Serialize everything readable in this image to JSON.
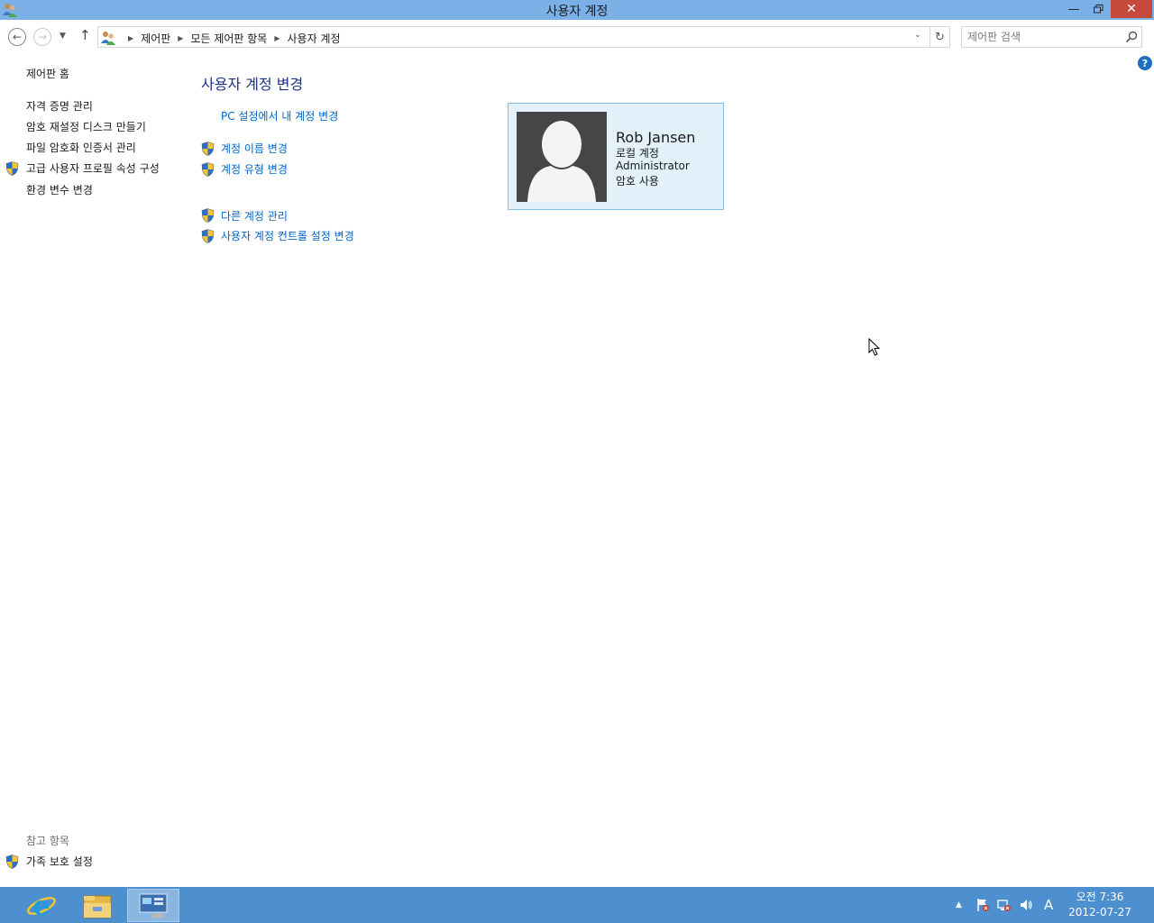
{
  "window": {
    "title": "사용자 계정",
    "colors": {
      "titlebar": "#7cb1e8",
      "close": "#c7493c",
      "taskbar": "#4d8fcf",
      "link": "#0066cc",
      "heading": "#1e3287"
    }
  },
  "nav": {
    "breadcrumbs": [
      "제어판",
      "모든 제어판 항목",
      "사용자 계정"
    ],
    "search_placeholder": "제어판 검색"
  },
  "left_pane": {
    "home": "제어판 홈",
    "links": [
      {
        "label": "자격 증명 관리",
        "shield": false
      },
      {
        "label": "암호 재설정 디스크 만들기",
        "shield": false
      },
      {
        "label": "파일 암호화 인증서 관리",
        "shield": false
      },
      {
        "label": "고급 사용자 프로필 속성 구성",
        "shield": true
      },
      {
        "label": "환경 변수 변경",
        "shield": false
      }
    ],
    "see_also": {
      "title": "참고 항목",
      "items": [
        {
          "label": "가족 보호 설정",
          "shield": true
        }
      ]
    }
  },
  "main": {
    "title": "사용자 계정 변경",
    "tasks": [
      {
        "label": "PC 설정에서 내 계정 변경",
        "shield": false
      },
      {
        "label": "계정 이름 변경",
        "shield": true
      },
      {
        "label": "계정 유형 변경",
        "shield": true
      },
      {
        "label": "다른 계정 관리",
        "shield": true
      },
      {
        "label": "사용자 계정 컨트롤 설정 변경",
        "shield": true
      }
    ],
    "user": {
      "name": "Rob Jansen",
      "account_type": "로컬 계정",
      "role": "Administrator",
      "password": "암호 사용"
    }
  },
  "taskbar": {
    "apps": [
      "internet-explorer-icon",
      "file-explorer-icon",
      "control-panel-icon"
    ],
    "ime": "A",
    "time": "오전 7:36",
    "date": "2012-07-27"
  }
}
